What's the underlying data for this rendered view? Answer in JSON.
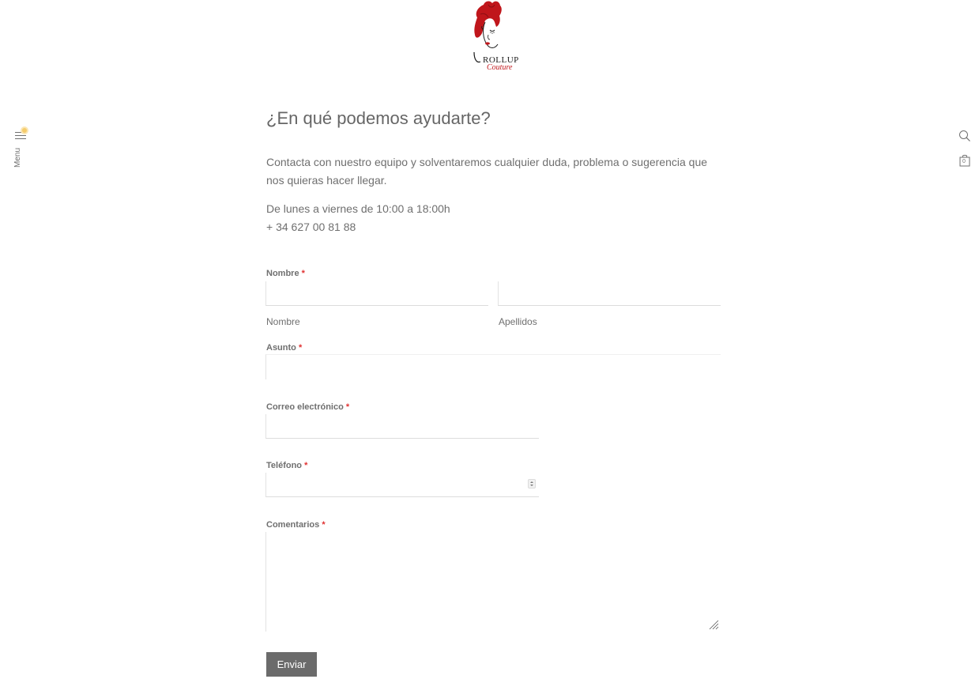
{
  "brand": {
    "logo_main": "ROLLUP",
    "logo_sub": "Couture",
    "colors": {
      "accent": "#c0161b",
      "text": "#6f6f6f",
      "button": "#6b6b6b",
      "indicator": "#f5cc6b"
    }
  },
  "nav": {
    "menu_label": "Menu",
    "menu_icon": "hamburger-icon",
    "search_icon": "search-icon",
    "cart_icon": "shopping-bag-icon",
    "cart_count": "0"
  },
  "page": {
    "title": "¿En qué podemos ayudarte?",
    "intro": "Contacta con nuestro equipo y solventaremos cualquier duda, problema o sugerencia que nos quieras hacer llegar.",
    "hours": "De lunes a viernes de 10:00 a 18:00h",
    "phone": "+ 34 627 00 81 88"
  },
  "form": {
    "name": {
      "label": "Nombre",
      "first_sublabel": "Nombre",
      "last_sublabel": "Apellidos",
      "first_value": "",
      "last_value": ""
    },
    "subject": {
      "label": "Asunto",
      "value": ""
    },
    "email": {
      "label": "Correo electrónico",
      "value": ""
    },
    "phone": {
      "label": "Teléfono",
      "value": ""
    },
    "comments": {
      "label": "Comentarios",
      "value": ""
    },
    "required_mark": "*",
    "submit_label": "Enviar"
  }
}
